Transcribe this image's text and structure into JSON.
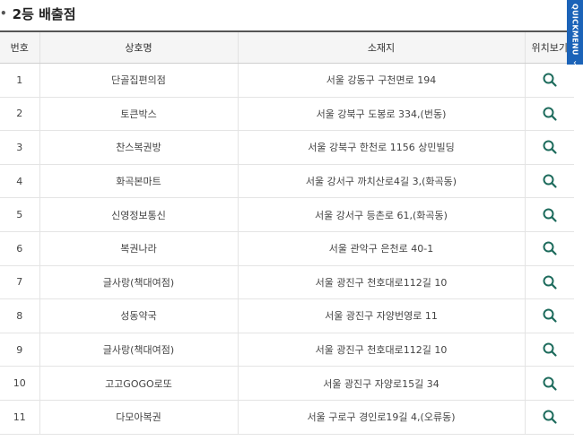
{
  "section": {
    "title": "2등 배출점"
  },
  "table": {
    "headers": [
      "번호",
      "상호명",
      "소재지",
      "위치보기"
    ],
    "rows": [
      {
        "no": "1",
        "name": "단골집편의점",
        "address": "서울 강동구 구천면로 194"
      },
      {
        "no": "2",
        "name": "토큰박스",
        "address": "서울 강북구 도봉로 334,(번동)"
      },
      {
        "no": "3",
        "name": "찬스복권방",
        "address": "서울 강북구 한천로 1156 상민빌딩"
      },
      {
        "no": "4",
        "name": "화곡본마트",
        "address": "서울 강서구 까치산로4길 3,(화곡동)"
      },
      {
        "no": "5",
        "name": "신영정보통신",
        "address": "서울 강서구 등촌로 61,(화곡동)"
      },
      {
        "no": "6",
        "name": "복권나라",
        "address": "서울 관악구 은천로 40-1"
      },
      {
        "no": "7",
        "name": "글사랑(책대여점)",
        "address": "서울 광진구 천호대로112길 10"
      },
      {
        "no": "8",
        "name": "성동약국",
        "address": "서울 광진구 자양번영로 11"
      },
      {
        "no": "9",
        "name": "글사랑(책대여점)",
        "address": "서울 광진구 천호대로112길 10"
      },
      {
        "no": "10",
        "name": "고고GOGO로또",
        "address": "서울 광진구 자양로15길 34"
      },
      {
        "no": "11",
        "name": "다모아복권",
        "address": "서울 구로구 경인로19길 4,(오류동)"
      }
    ]
  },
  "quickmenu": {
    "label": "QUICKMENU",
    "arrow": "‹"
  },
  "colors": {
    "accent": "#1b63b8",
    "search_icon": "#1d6b5c"
  }
}
